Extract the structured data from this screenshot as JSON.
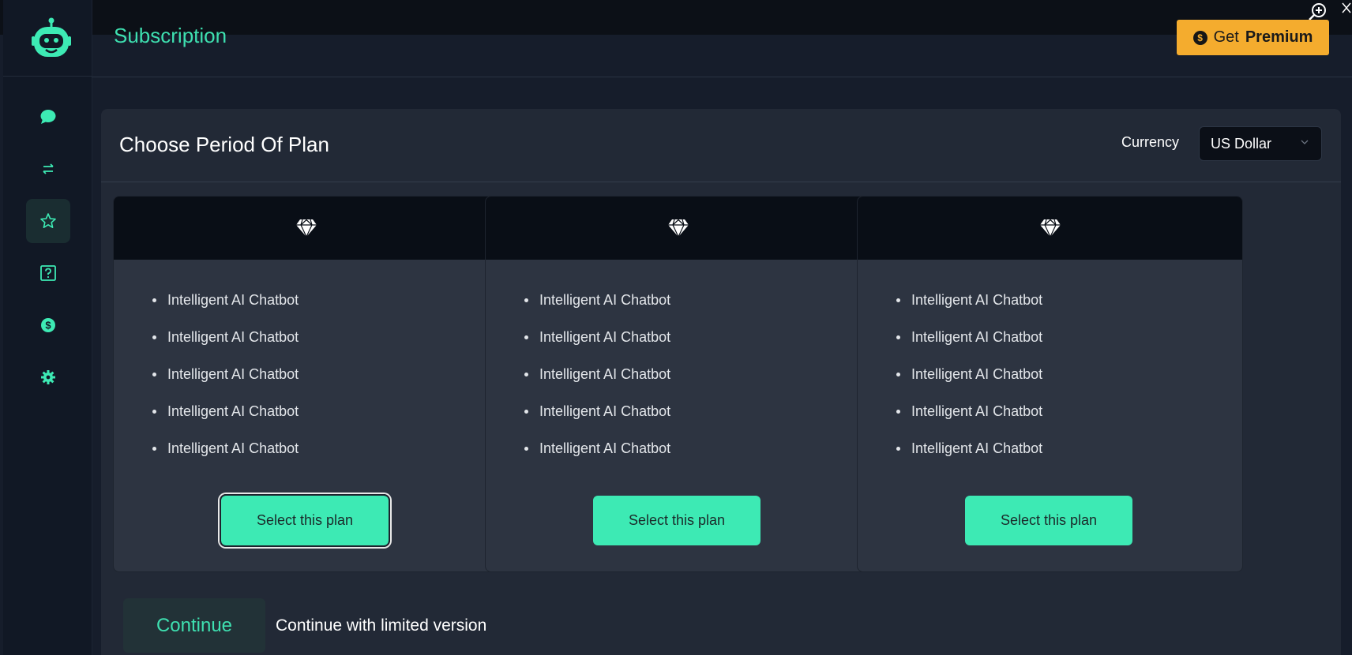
{
  "header": {
    "title": "Subscription",
    "premium_button": {
      "prefix": "Get",
      "bold": "Premium",
      "icon": "dollar-coin-icon"
    }
  },
  "sidebar": {
    "items": [
      {
        "name": "chat",
        "icon": "chat-bubble-icon",
        "active": false
      },
      {
        "name": "transfer",
        "icon": "swap-arrows-icon",
        "active": false
      },
      {
        "name": "favorites",
        "icon": "star-icon",
        "active": true
      },
      {
        "name": "help",
        "icon": "question-box-icon",
        "active": false
      },
      {
        "name": "billing",
        "icon": "dollar-coin-icon",
        "active": false
      },
      {
        "name": "settings",
        "icon": "gear-icon",
        "active": false
      }
    ]
  },
  "panel": {
    "title": "Choose Period Of Plan",
    "currency_label": "Currency",
    "currency_value": "US Dollar"
  },
  "plans": [
    {
      "icon": "diamond-icon",
      "features": [
        "Intelligent AI Chatbot",
        "Intelligent AI Chatbot",
        "Intelligent AI Chatbot",
        "Intelligent AI Chatbot",
        "Intelligent AI Chatbot"
      ],
      "button": "Select this plan",
      "focused": true
    },
    {
      "icon": "diamond-icon",
      "features": [
        "Intelligent AI Chatbot",
        "Intelligent AI Chatbot",
        "Intelligent AI Chatbot",
        "Intelligent AI Chatbot",
        "Intelligent AI Chatbot"
      ],
      "button": "Select this plan",
      "focused": false
    },
    {
      "icon": "diamond-icon",
      "features": [
        "Intelligent AI Chatbot",
        "Intelligent AI Chatbot",
        "Intelligent AI Chatbot",
        "Intelligent AI Chatbot",
        "Intelligent AI Chatbot"
      ],
      "button": "Select this plan",
      "focused": false
    }
  ],
  "footer": {
    "continue_button": "Continue",
    "limited_link": "Continue with limited version"
  },
  "colors": {
    "accent": "#3deab4",
    "premium": "#f4ac2e",
    "background": "#161d2b",
    "panel": "#222936",
    "card": "#2d3441"
  }
}
